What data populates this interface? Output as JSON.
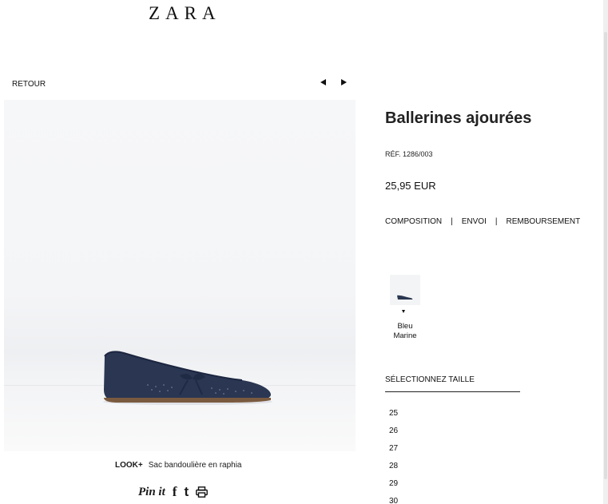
{
  "header": {
    "brand": "ZARA"
  },
  "nav": {
    "back_label": "RETOUR",
    "prev_icon": "triangle-left-icon",
    "next_icon": "triangle-right-icon"
  },
  "product": {
    "title": "Ballerines ajourées",
    "ref": "RÉF. 1286/003",
    "price": "25,95 EUR",
    "image_icon": "navy-ballerina-shoe"
  },
  "info_links": {
    "composition": "COMPOSITION",
    "separator": "|",
    "envoi": "ENVOI",
    "remboursement": "REMBOURSEMENT"
  },
  "colors": {
    "selected_line1": "Bleu",
    "selected_line2": "Marine",
    "swatch_color": "#2b3750"
  },
  "sizes": {
    "title": "SÉLECTIONNEZ TAILLE",
    "items": [
      "25",
      "26",
      "27",
      "28",
      "29",
      "30"
    ]
  },
  "look": {
    "label": "LOOK+",
    "text": "Sac bandoulière en raphia"
  },
  "share": {
    "pinterest": "Pin it",
    "facebook": "f",
    "twitter": "t",
    "print_icon": "print-icon"
  }
}
